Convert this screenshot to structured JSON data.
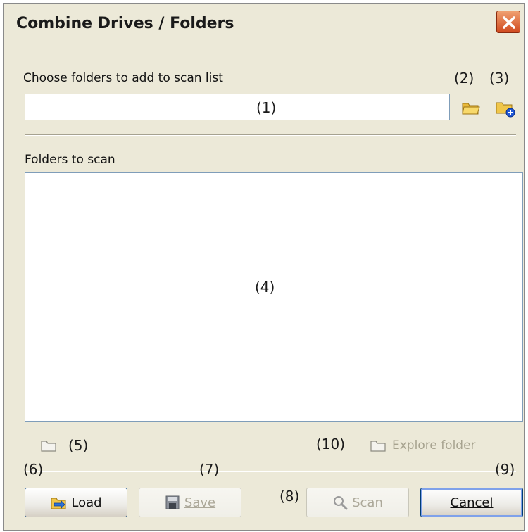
{
  "window": {
    "title": "Combine Drives / Folders"
  },
  "choose": {
    "label": "Choose folders to add to scan list",
    "input_marker": "(1)",
    "browse_marker": "(2)",
    "add_marker": "(3)"
  },
  "scan_list": {
    "label": "Folders to scan",
    "marker": "(4)"
  },
  "footer": {
    "folder_marker": "(5)",
    "explore_marker": "(10)",
    "explore_label": "Explore folder"
  },
  "buttons": {
    "load_marker": "(6)",
    "load_label": "Load",
    "save_marker": "(7)",
    "save_label": "Save",
    "scan_marker": "(8)",
    "scan_label": "Scan",
    "cancel_marker": "(9)",
    "cancel_label": "Cancel"
  },
  "icons": {
    "close": "close-icon",
    "browse": "folder-open-icon",
    "add": "folder-add-icon",
    "folder_small": "folder-icon",
    "explore": "folder-icon",
    "load": "load-icon",
    "save": "floppy-disk-icon",
    "scan": "magnifier-icon"
  },
  "colors": {
    "dialog_bg": "#ece9d8",
    "close_button": "#d04a1f",
    "input_border": "#7f9db9",
    "disabled_text": "#aca899"
  }
}
